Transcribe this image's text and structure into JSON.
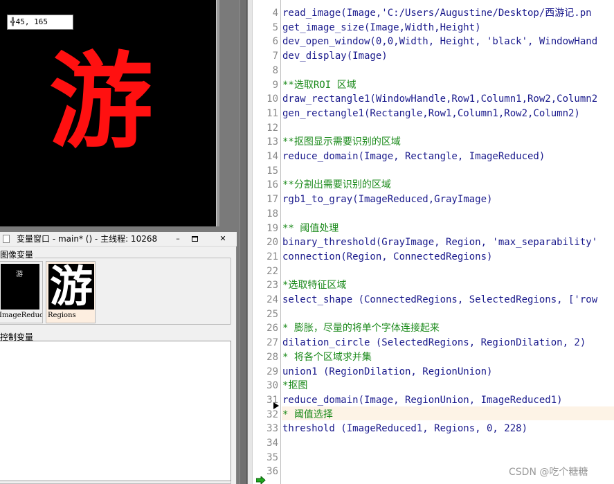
{
  "graphics_window": {
    "coordinate_readout": "45, 165",
    "displayed_character": "游"
  },
  "variable_window": {
    "title": "变量窗口 - main* () - 主线程: 10268",
    "controls": {
      "minimize": "–",
      "close": "✕"
    },
    "image_group_label": "图像变量",
    "control_group_label": "控制变量",
    "thumbnails": [
      {
        "label": "ImageReduced",
        "preview_text": "游"
      },
      {
        "label": "Regions",
        "preview_text": "游"
      }
    ]
  },
  "editor": {
    "lines": [
      {
        "num": "4",
        "text": "read_image(Image,'C:/Users/Augustine/Desktop/西游记.pn",
        "kind": "code"
      },
      {
        "num": "5",
        "text": "get_image_size(Image,Width,Height)",
        "kind": "code"
      },
      {
        "num": "6",
        "text": "dev_open_window(0,0,Width, Height, 'black', WindowHand",
        "kind": "code"
      },
      {
        "num": "7",
        "text": "dev_display(Image)",
        "kind": "code"
      },
      {
        "num": "8",
        "text": "",
        "kind": "code"
      },
      {
        "num": "9",
        "text": "**选取ROI 区域",
        "kind": "comment"
      },
      {
        "num": "10",
        "text": "draw_rectangle1(WindowHandle,Row1,Column1,Row2,Column2",
        "kind": "code"
      },
      {
        "num": "11",
        "text": "gen_rectangle1(Rectangle,Row1,Column1,Row2,Column2)",
        "kind": "code"
      },
      {
        "num": "12",
        "text": "",
        "kind": "code"
      },
      {
        "num": "13",
        "text": "**抠图显示需要识别的区域",
        "kind": "comment"
      },
      {
        "num": "14",
        "text": "reduce_domain(Image, Rectangle, ImageReduced)",
        "kind": "code"
      },
      {
        "num": "15",
        "text": "",
        "kind": "code"
      },
      {
        "num": "16",
        "text": "**分割出需要识别的区域",
        "kind": "comment"
      },
      {
        "num": "17",
        "text": "rgb1_to_gray(ImageReduced,GrayImage)",
        "kind": "code"
      },
      {
        "num": "18",
        "text": "",
        "kind": "code"
      },
      {
        "num": "19",
        "text": "** 阈值处理",
        "kind": "comment"
      },
      {
        "num": "20",
        "text": "binary_threshold(GrayImage, Region, 'max_separability'",
        "kind": "code"
      },
      {
        "num": "21",
        "text": "connection(Region, ConnectedRegions)",
        "kind": "code"
      },
      {
        "num": "22",
        "text": "",
        "kind": "code"
      },
      {
        "num": "23",
        "text": "*选取特征区域",
        "kind": "comment"
      },
      {
        "num": "24",
        "text": "select_shape (ConnectedRegions, SelectedRegions, ['row",
        "kind": "code"
      },
      {
        "num": "25",
        "text": "",
        "kind": "code"
      },
      {
        "num": "26",
        "text": "* 膨胀，尽量的将单个字体连接起来",
        "kind": "comment"
      },
      {
        "num": "27",
        "text": "dilation_circle (SelectedRegions, RegionDilation, 2)",
        "kind": "code"
      },
      {
        "num": "28",
        "text": "* 将各个区域求并集",
        "kind": "comment"
      },
      {
        "num": "29",
        "text": "union1 (RegionDilation, RegionUnion)",
        "kind": "code"
      },
      {
        "num": "30",
        "text": "*抠图",
        "kind": "comment"
      },
      {
        "num": "31",
        "text": "reduce_domain(Image, RegionUnion, ImageReduced1)",
        "kind": "code"
      },
      {
        "num": "32",
        "text": "* 阈值选择",
        "kind": "comment"
      },
      {
        "num": "33",
        "text": "threshold (ImageReduced1, Regions, 0, 228)",
        "kind": "code"
      },
      {
        "num": "34",
        "text": "",
        "kind": "code"
      },
      {
        "num": "35",
        "text": "",
        "kind": "code"
      },
      {
        "num": "36",
        "text": "",
        "kind": "code"
      }
    ]
  },
  "watermark": "CSDN @吃个糖糖",
  "colors": {
    "code_text": "#1a1a8c",
    "comment_text": "#1b8a1b",
    "current_line": "#fdf3e6",
    "display_char": "#ff1010"
  }
}
